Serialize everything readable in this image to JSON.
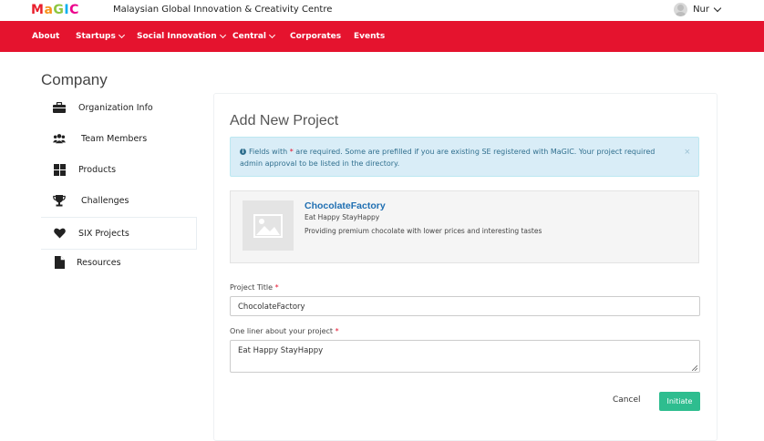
{
  "header": {
    "logo_text": "MaGIC",
    "org_name": "Malaysian Global Innovation & Creativity Centre",
    "user_name": "Nur"
  },
  "nav": {
    "items": [
      {
        "label": "About",
        "has_dropdown": false
      },
      {
        "label": "Startups",
        "has_dropdown": true
      },
      {
        "label": "Social Innovation",
        "has_dropdown": true
      },
      {
        "label": "Central",
        "has_dropdown": true
      },
      {
        "label": "Corporates",
        "has_dropdown": false
      },
      {
        "label": "Events",
        "has_dropdown": false
      }
    ],
    "color": "#e5132e"
  },
  "sidebar": {
    "title": "Company",
    "items": [
      {
        "label": "Organization Info",
        "icon": "briefcase-icon"
      },
      {
        "label": "Team Members",
        "icon": "users-icon"
      },
      {
        "label": "Products",
        "icon": "grid-icon"
      },
      {
        "label": "Challenges",
        "icon": "trophy-icon"
      },
      {
        "label": "SIX Projects",
        "icon": "heart-icon",
        "active": true
      },
      {
        "label": "Resources",
        "icon": "file-icon"
      }
    ]
  },
  "main": {
    "title": "Add New Project",
    "alert": {
      "prefix": "Fields with",
      "star": "*",
      "suffix": "are required. Some are prefilled if you are existing SE registered with MaGIC. Your project required admin approval to be listed in the directory.",
      "close": "×"
    },
    "preview": {
      "name": "ChocolateFactory",
      "tagline": "Eat Happy StayHappy",
      "description": "Providing premium chocolate with lower prices and interesting tastes"
    },
    "form": {
      "project_title_label": "Project Title",
      "project_title_value": "ChocolateFactory",
      "one_liner_label": "One liner about your project",
      "one_liner_value": "Eat Happy StayHappy",
      "required_mark": "*"
    },
    "actions": {
      "cancel": "Cancel",
      "initiate": "Initiate"
    }
  },
  "colors": {
    "accent_red": "#e5132e",
    "success_green": "#2ebd8f",
    "link_blue": "#1f6fb2",
    "alert_bg": "#d9edf7"
  }
}
